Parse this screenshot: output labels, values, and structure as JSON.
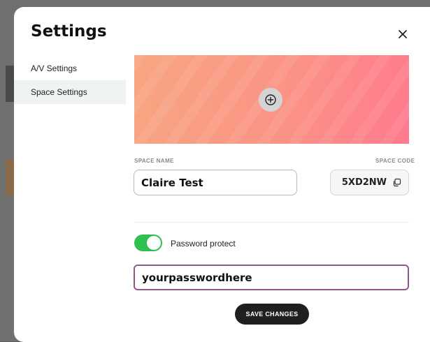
{
  "modal": {
    "title": "Settings",
    "close_icon": "close-icon"
  },
  "sidebar": {
    "items": [
      {
        "label": "A/V Settings",
        "active": false
      },
      {
        "label": "Space Settings",
        "active": true
      }
    ]
  },
  "banner": {
    "colors": [
      "#f7a682",
      "#ff7a8e"
    ],
    "upload_icon": "add-circle-icon"
  },
  "space_name": {
    "label": "SPACE NAME",
    "value": "Claire Test"
  },
  "space_code": {
    "label": "SPACE CODE",
    "value": "5XD2NW",
    "copy_icon": "copy-icon"
  },
  "password": {
    "toggle_label": "Password protect",
    "enabled": true,
    "value": "yourpasswordhere"
  },
  "actions": {
    "save_label": "SAVE CHANGES"
  },
  "colors": {
    "toggle_on": "#2fbf4e",
    "focus_border": "#8e5a8b",
    "save_button": "#1f1f1f",
    "active_nav": "#eef3f3"
  }
}
